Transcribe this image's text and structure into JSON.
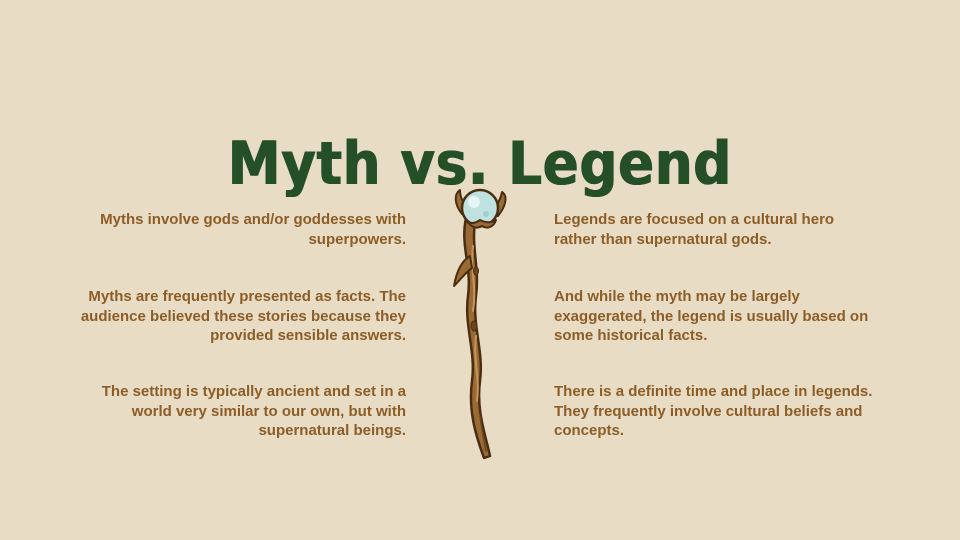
{
  "slide": {
    "title": "Myth vs. Legend",
    "left_points": [
      "Myths involve gods and/or goddesses with superpowers.",
      "Myths are frequently presented as facts. The audience believed these stories because they provided sensible answers.",
      "The setting is typically ancient and set in a world very similar to our own, but with supernatural beings."
    ],
    "right_points": [
      "Legends are focused on a cultural hero rather than supernatural gods.",
      "And while the myth may be largely exaggerated, the legend is usually based on some historical facts.",
      "There is a definite time and place in legends. They frequently involve cultural beliefs and concepts."
    ]
  },
  "colors": {
    "background": "#e8dcc5",
    "title": "#244f27",
    "body_text": "#8c5d27",
    "staff_wood": "#9a6a33",
    "staff_orb": "#bfe1e0"
  },
  "icons": {
    "center_illustration": "wizard-staff-icon"
  }
}
